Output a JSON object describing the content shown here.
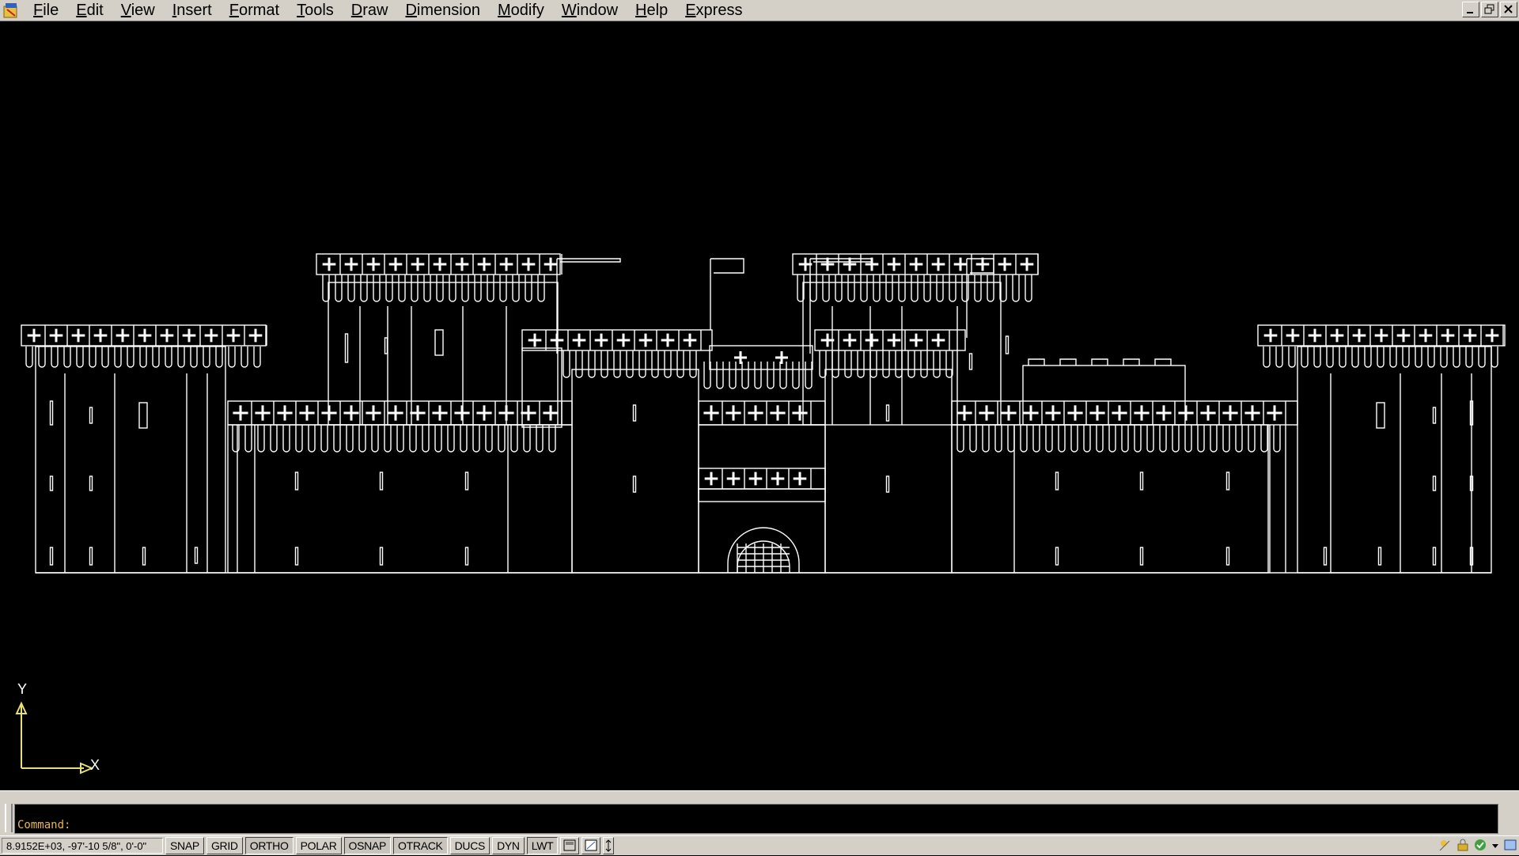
{
  "menubar": {
    "items": [
      "File",
      "Edit",
      "View",
      "Insert",
      "Format",
      "Tools",
      "Draw",
      "Dimension",
      "Modify",
      "Window",
      "Help",
      "Express"
    ]
  },
  "window_controls": [
    "minimize-icon",
    "restore-icon",
    "close-icon"
  ],
  "ucs": {
    "x_label": "X",
    "y_label": "Y"
  },
  "command": {
    "prompt": "Command:"
  },
  "statusbar": {
    "coordinates": "8.9152E+03,  -97'-10 5/8\", 0'-0\"",
    "toggles": [
      {
        "label": "SNAP",
        "on": false
      },
      {
        "label": "GRID",
        "on": false
      },
      {
        "label": "ORTHO",
        "on": true
      },
      {
        "label": "POLAR",
        "on": false
      },
      {
        "label": "OSNAP",
        "on": true
      },
      {
        "label": "OTRACK",
        "on": true
      },
      {
        "label": "DUCS",
        "on": false
      },
      {
        "label": "DYN",
        "on": false
      },
      {
        "label": "LWT",
        "on": true
      }
    ]
  },
  "colors": {
    "canvas": "#000000",
    "linework": "#ffffff",
    "ucs": "#e8e070",
    "command_text": "#e8b84a",
    "chrome": "#d4d0c8"
  }
}
